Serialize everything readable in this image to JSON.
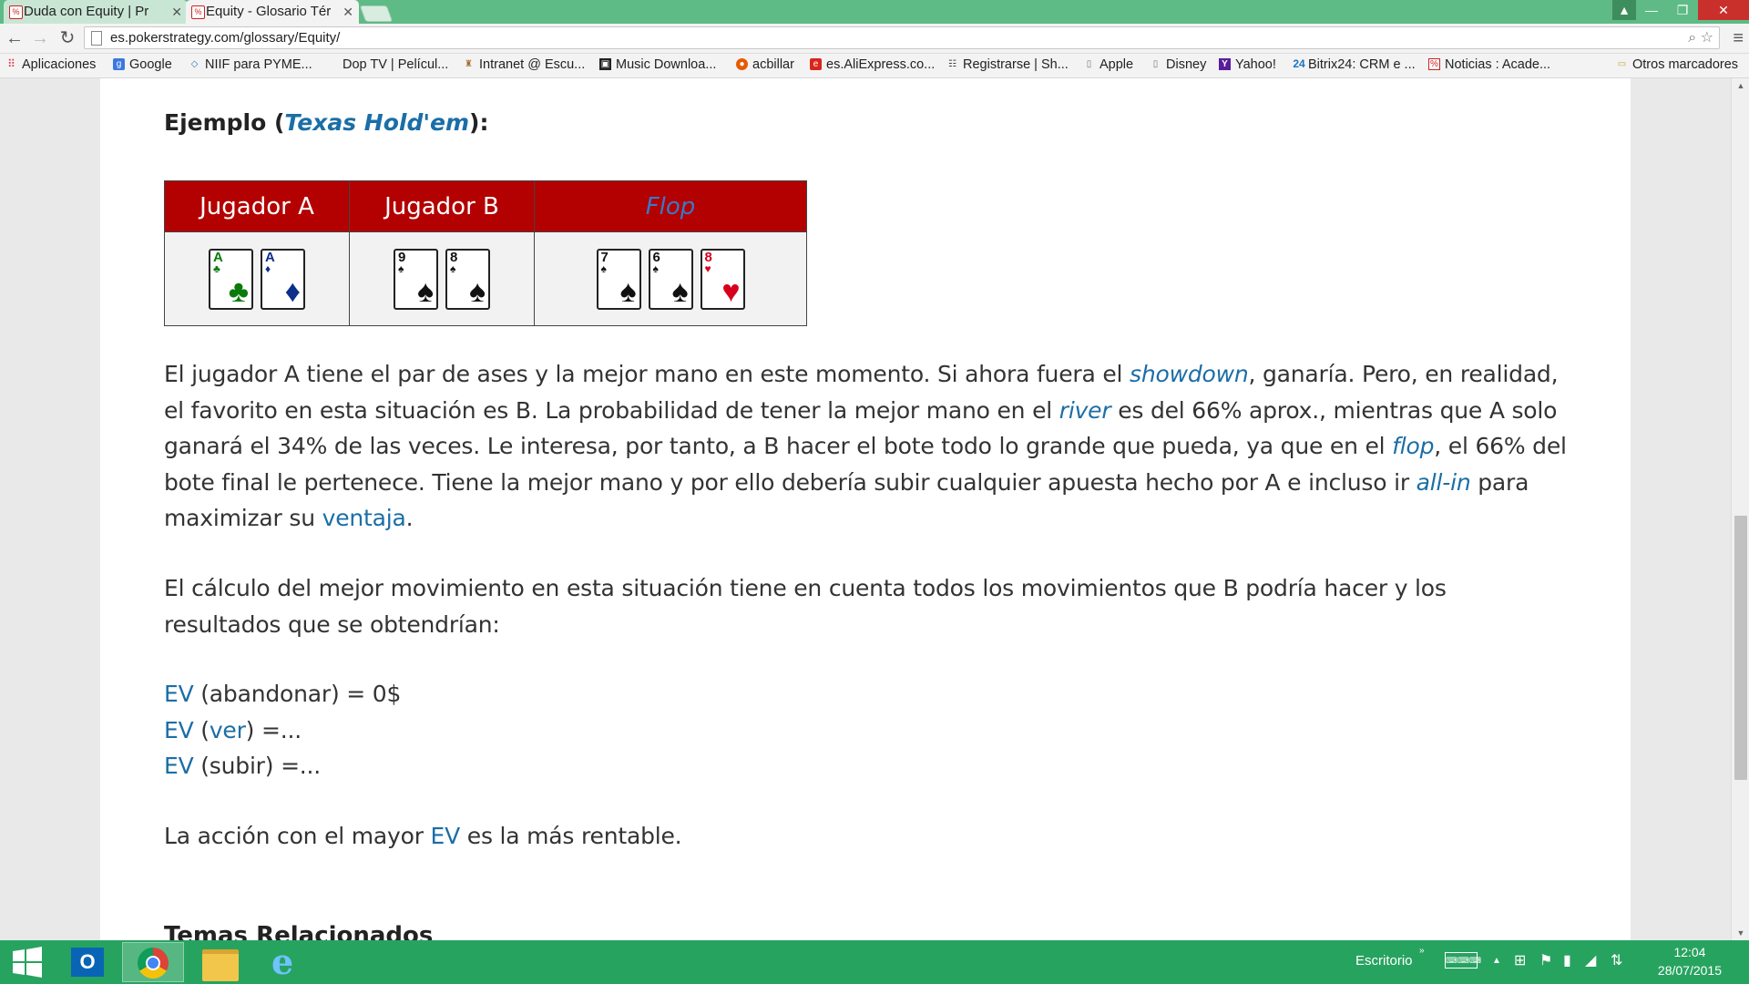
{
  "browser": {
    "tabs": [
      {
        "label": "Duda con Equity | Pr",
        "active": false
      },
      {
        "label": "Equity - Glosario Tér",
        "active": true
      }
    ],
    "url": "es.pokerstrategy.com/glossary/Equity/",
    "window_controls": {
      "minimize": "—",
      "maximize": "❐",
      "close": "✕"
    }
  },
  "bookmarks": [
    {
      "label": "Aplicaciones",
      "icon": "apps-grid-icon"
    },
    {
      "label": "Google",
      "icon": "google-icon"
    },
    {
      "label": "NIIF para PYME...",
      "icon": "niif-icon"
    },
    {
      "label": "Dop TV | Películ...",
      "icon": ""
    },
    {
      "label": "Intranet @ Escu...",
      "icon": "intranet-icon"
    },
    {
      "label": "Music Downloa...",
      "icon": "music-icon"
    },
    {
      "label": "acbillar",
      "icon": "acbillar-icon"
    },
    {
      "label": "es.AliExpress.co...",
      "icon": "aliexpress-icon"
    },
    {
      "label": "Registrarse | Sh...",
      "icon": "register-icon"
    },
    {
      "label": "Apple",
      "icon": "page-icon"
    },
    {
      "label": "Disney",
      "icon": "page-icon"
    },
    {
      "label": "Yahoo!",
      "icon": "yahoo-icon"
    },
    {
      "label": "Bitrix24: CRM e ...",
      "icon": "bitrix-icon"
    },
    {
      "label": "Noticias : Acade...",
      "icon": "noticias-icon"
    }
  ],
  "other_bookmarks": "Otros marcadores",
  "article": {
    "example_prefix": "Ejemplo (",
    "example_link": "Texas Hold'em",
    "example_suffix": "):",
    "table": {
      "headers": [
        "Jugador A",
        "Jugador B",
        "Flop"
      ],
      "hands": [
        [
          {
            "rank": "A",
            "suit": "♣",
            "color": "#0a7a0a"
          },
          {
            "rank": "A",
            "suit": "♦",
            "color": "#0b2f8a"
          }
        ],
        [
          {
            "rank": "9",
            "suit": "♠",
            "color": "#111111"
          },
          {
            "rank": "8",
            "suit": "♠",
            "color": "#111111"
          }
        ],
        [
          {
            "rank": "7",
            "suit": "♠",
            "color": "#111111"
          },
          {
            "rank": "6",
            "suit": "♠",
            "color": "#111111"
          },
          {
            "rank": "8",
            "suit": "♥",
            "color": "#d6001c"
          }
        ]
      ]
    },
    "p1": {
      "t1": "El jugador A tiene el par de ases y la mejor mano en este momento. Si ahora fuera el ",
      "l1": "showdown",
      "t2": ", ganaría. Pero, en realidad, el favorito en esta situación es B. La probabilidad de tener la mejor mano en el ",
      "l2": "river",
      "t3": " es del 66% aprox., mientras que A solo ganará el 34% de las veces. Le interesa, por tanto, a B hacer el bote todo lo grande que pueda, ya que en el ",
      "l3": "flop",
      "t4": ", el 66% del bote final le pertenece. Tiene la mejor mano y por ello debería subir cualquier apuesta hecho por A e incluso ir ",
      "l4": "all-in",
      "t5": " para maximizar su ",
      "l5": "ventaja",
      "t6": "."
    },
    "p2": "El cálculo del mejor movimiento en esta situación tiene en cuenta todos los movimientos que B podría hacer y los resultados que se obtendrían:",
    "ev_lines": [
      {
        "ev": "EV",
        "rest": " (abandonar) = 0$"
      },
      {
        "ev": "EV",
        "pre": " (",
        "link": "ver",
        "rest": ") =..."
      },
      {
        "ev": "EV",
        "rest": " (subir) =..."
      }
    ],
    "p4": {
      "t1": "La acción con el mayor ",
      "l1": "EV",
      "t2": " es la más rentable."
    },
    "related_heading": "Temas Relacionados"
  },
  "taskbar": {
    "desktop_label": "Escritorio",
    "time": "12:04",
    "date": "28/07/2015"
  },
  "colors": {
    "accent_green": "#27a360",
    "table_header_red": "#b30000",
    "link_blue": "#1b6ea6"
  }
}
